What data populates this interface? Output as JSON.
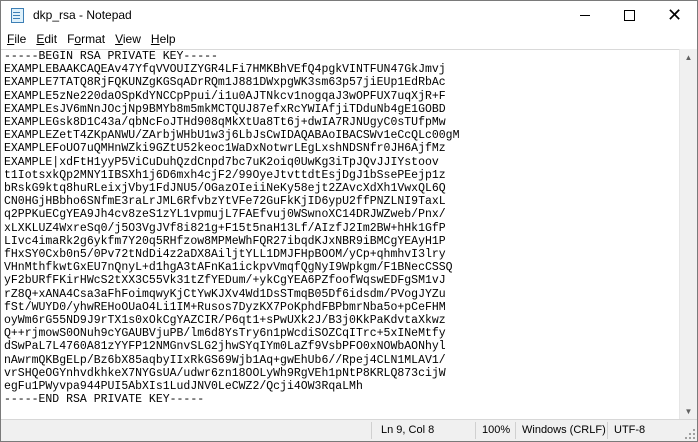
{
  "window": {
    "title": "dkp_rsa - Notepad"
  },
  "menu": [
    {
      "label": "File",
      "key": "F",
      "rest": "ile"
    },
    {
      "label": "Edit",
      "key": "E",
      "rest": "dit"
    },
    {
      "label": "Format",
      "key": "o",
      "pre": "F",
      "rest": "rmat"
    },
    {
      "label": "View",
      "key": "V",
      "rest": "iew"
    },
    {
      "label": "Help",
      "key": "H",
      "rest": "elp"
    }
  ],
  "editor": {
    "lines": [
      "-----BEGIN RSA PRIVATE KEY-----",
      "EXAMPLEBAAKCAQEAv47YfqVVOUIZYGR4LFi7HMKBhVEfQ4pgkVINTFUN47GkJmvj",
      "EXAMPLE7TATQ8RjFQKUNZgKGSqADrRQm1J881DWxpgWK3sm63p57jiEUp1EdRbAc",
      "EXAMPLE5zNe220daOSpKdYNCCpPpui/i1u0AJTNkcv1nogqaJ3wOPFUX7uqXjR+F",
      "EXAMPLEsJV6mNnJOcjNp9BMYb8m5mkMCTQUJ87efxRcYWIAfjiTDduNb4gE1GOBD",
      "EXAMPLEGsk8D1C43a/qbNcFoJTHd908qMkXtUa8Tt6j+dwIA7RJNUgyC0sTUfpMw",
      "EXAMPLEZetT4ZKpANWU/ZArbjWHbU1w3j6LbJsCwIDAQABAoIBACSWv1eCcQLc00gM",
      "EXAMPLEFoUO7uQMHnWZki9GZtU52keoc1WaDxNotwrLEgLxshNDSNfr0JH6AjfMz",
      "EXAMPLE|xdFtH1yyP5ViCuDuhQzdCnpd7bc7uK2oiq0UwKg3iTpJQvJJIYstoov",
      "t1IotsxkQp2MNY1IBSXh1j6D6mxh4cjF2/99OyeJtvttdtEsjDgJ1bSsePEejp1z",
      "bRskG9ktq8huRLeixjVby1FdJNU5/OGazOIeiiNeKy58ejt2ZAvcXdXh1VwxQL6Q",
      "CN0HGjHBbho6SNfmE3raLrJML6RfvbzYtVFe72GuFkKjID6ypU2ffPNZLNI9TaxL",
      "q2PPKuECgYEA9Jh4cv8zeS1zYL1vpmujL7FAEfvuj0WSwnoXC14DRJWZweb/Pnx/",
      "xLXKLUZ4WxreSq0/j5O3VgJVf8i821g+F15t5naH13Lf/AIzfJ2Im2BW+hHk1GfP",
      "LIvc4imaRk2g6ykfm7Y20q5RHfzow8MPMeWhFQR27ibqdKJxNBR9iBMCgYEAyH1P",
      "fHxSY0Cxb0n5/0Pv72tNdDi4z2aDX8AiljtYLL1DMJFHpBOOM/yCp+qhmhvI3lry",
      "VHnMthfkwtGxEU7nQnyL+d1hgA3tAFnKa1ickpvVmqfQgNyI9Wpkgm/F1BNecCSSQ",
      "yF2bURfFKirHWcS2tXX3C55Vk31tZfYEDum/+ykCgYEA6PZfoofWqswEDFgSM1vJ",
      "rZ8Q+xANA4Csa3aFhFoimqwyKjCtYwKJXv4Wd1DsSTmqB05Df6idsdm/PVogJYZu",
      "fSt/WUYD0/yhwREHoOUaO4Li1IM+Rusos7DyzKX7PoKphdFBPbmrNba5o+pCeFHM",
      "oyWm6rG55ND9J9rTX1s0xOkCgYAZCIR/P6qt1+sPwUXk2J/B3j0KkPaKdvtaXkwz",
      "Q++rjmowS0ONuh9cYGAUBVjuPB/lm6d8YsTry6n1pWcdiSOZCqITrc+5xINeMtfy",
      "dSwPaL7L4760A81zYYFP12NMGnvSLG2jhwSYqIYm0LaZf9VsbPFO0xNOWbAONhyl",
      "nAwrmQKBgELp/Bz6bX85aqbyIIxRkGS69Wjb1Aq+gwEhUb6//Rpej4CLN1MLAV1/",
      "vrSHQeOGYnhvdkhkeX7NYGsUA/udwr6zn18OOLyWh9RgVEh1pNtP8KRLQ873cijW",
      "egFu1PWyvpa944PUI5AbXIs1LudJNV0LeCWZ2/Qcji4OW3RqaLMh",
      "-----END RSA PRIVATE KEY-----"
    ]
  },
  "status": {
    "position": "Ln 9, Col 8",
    "zoom": "100%",
    "line_ending": "Windows (CRLF)",
    "encoding": "UTF-8"
  }
}
